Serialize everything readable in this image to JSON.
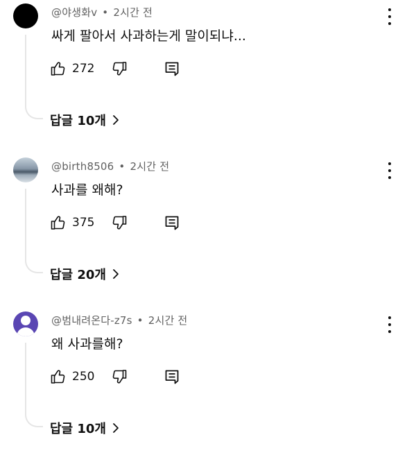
{
  "comments": [
    {
      "author": "@야생화v",
      "separator": "•",
      "time": "2시간 전",
      "text": "싸게 팔아서 사과하는게 말이되냐...",
      "likes": "272",
      "replies_label": "답글 10개",
      "avatar": "black-circle"
    },
    {
      "author": "@birth8506",
      "separator": "•",
      "time": "2시간 전",
      "text": "사과를 왜해?",
      "likes": "375",
      "replies_label": "답글 20개",
      "avatar": "sky-photo"
    },
    {
      "author": "@범내려온다-z7s",
      "separator": "•",
      "time": "2시간 전",
      "text": "왜 사과를해?",
      "likes": "250",
      "replies_label": "답글 10개",
      "avatar": "purple-default-person"
    }
  ],
  "icons": {
    "like": "thumb-up-icon",
    "dislike": "thumb-down-icon",
    "reply": "comment-icon",
    "more": "kebab-menu-icon",
    "expand": "chevron-right-icon"
  },
  "colors": {
    "text": "#0f0f0f",
    "meta": "#606060",
    "thread_line": "#e5e5e5",
    "purple_avatar": "#5a46b3"
  }
}
